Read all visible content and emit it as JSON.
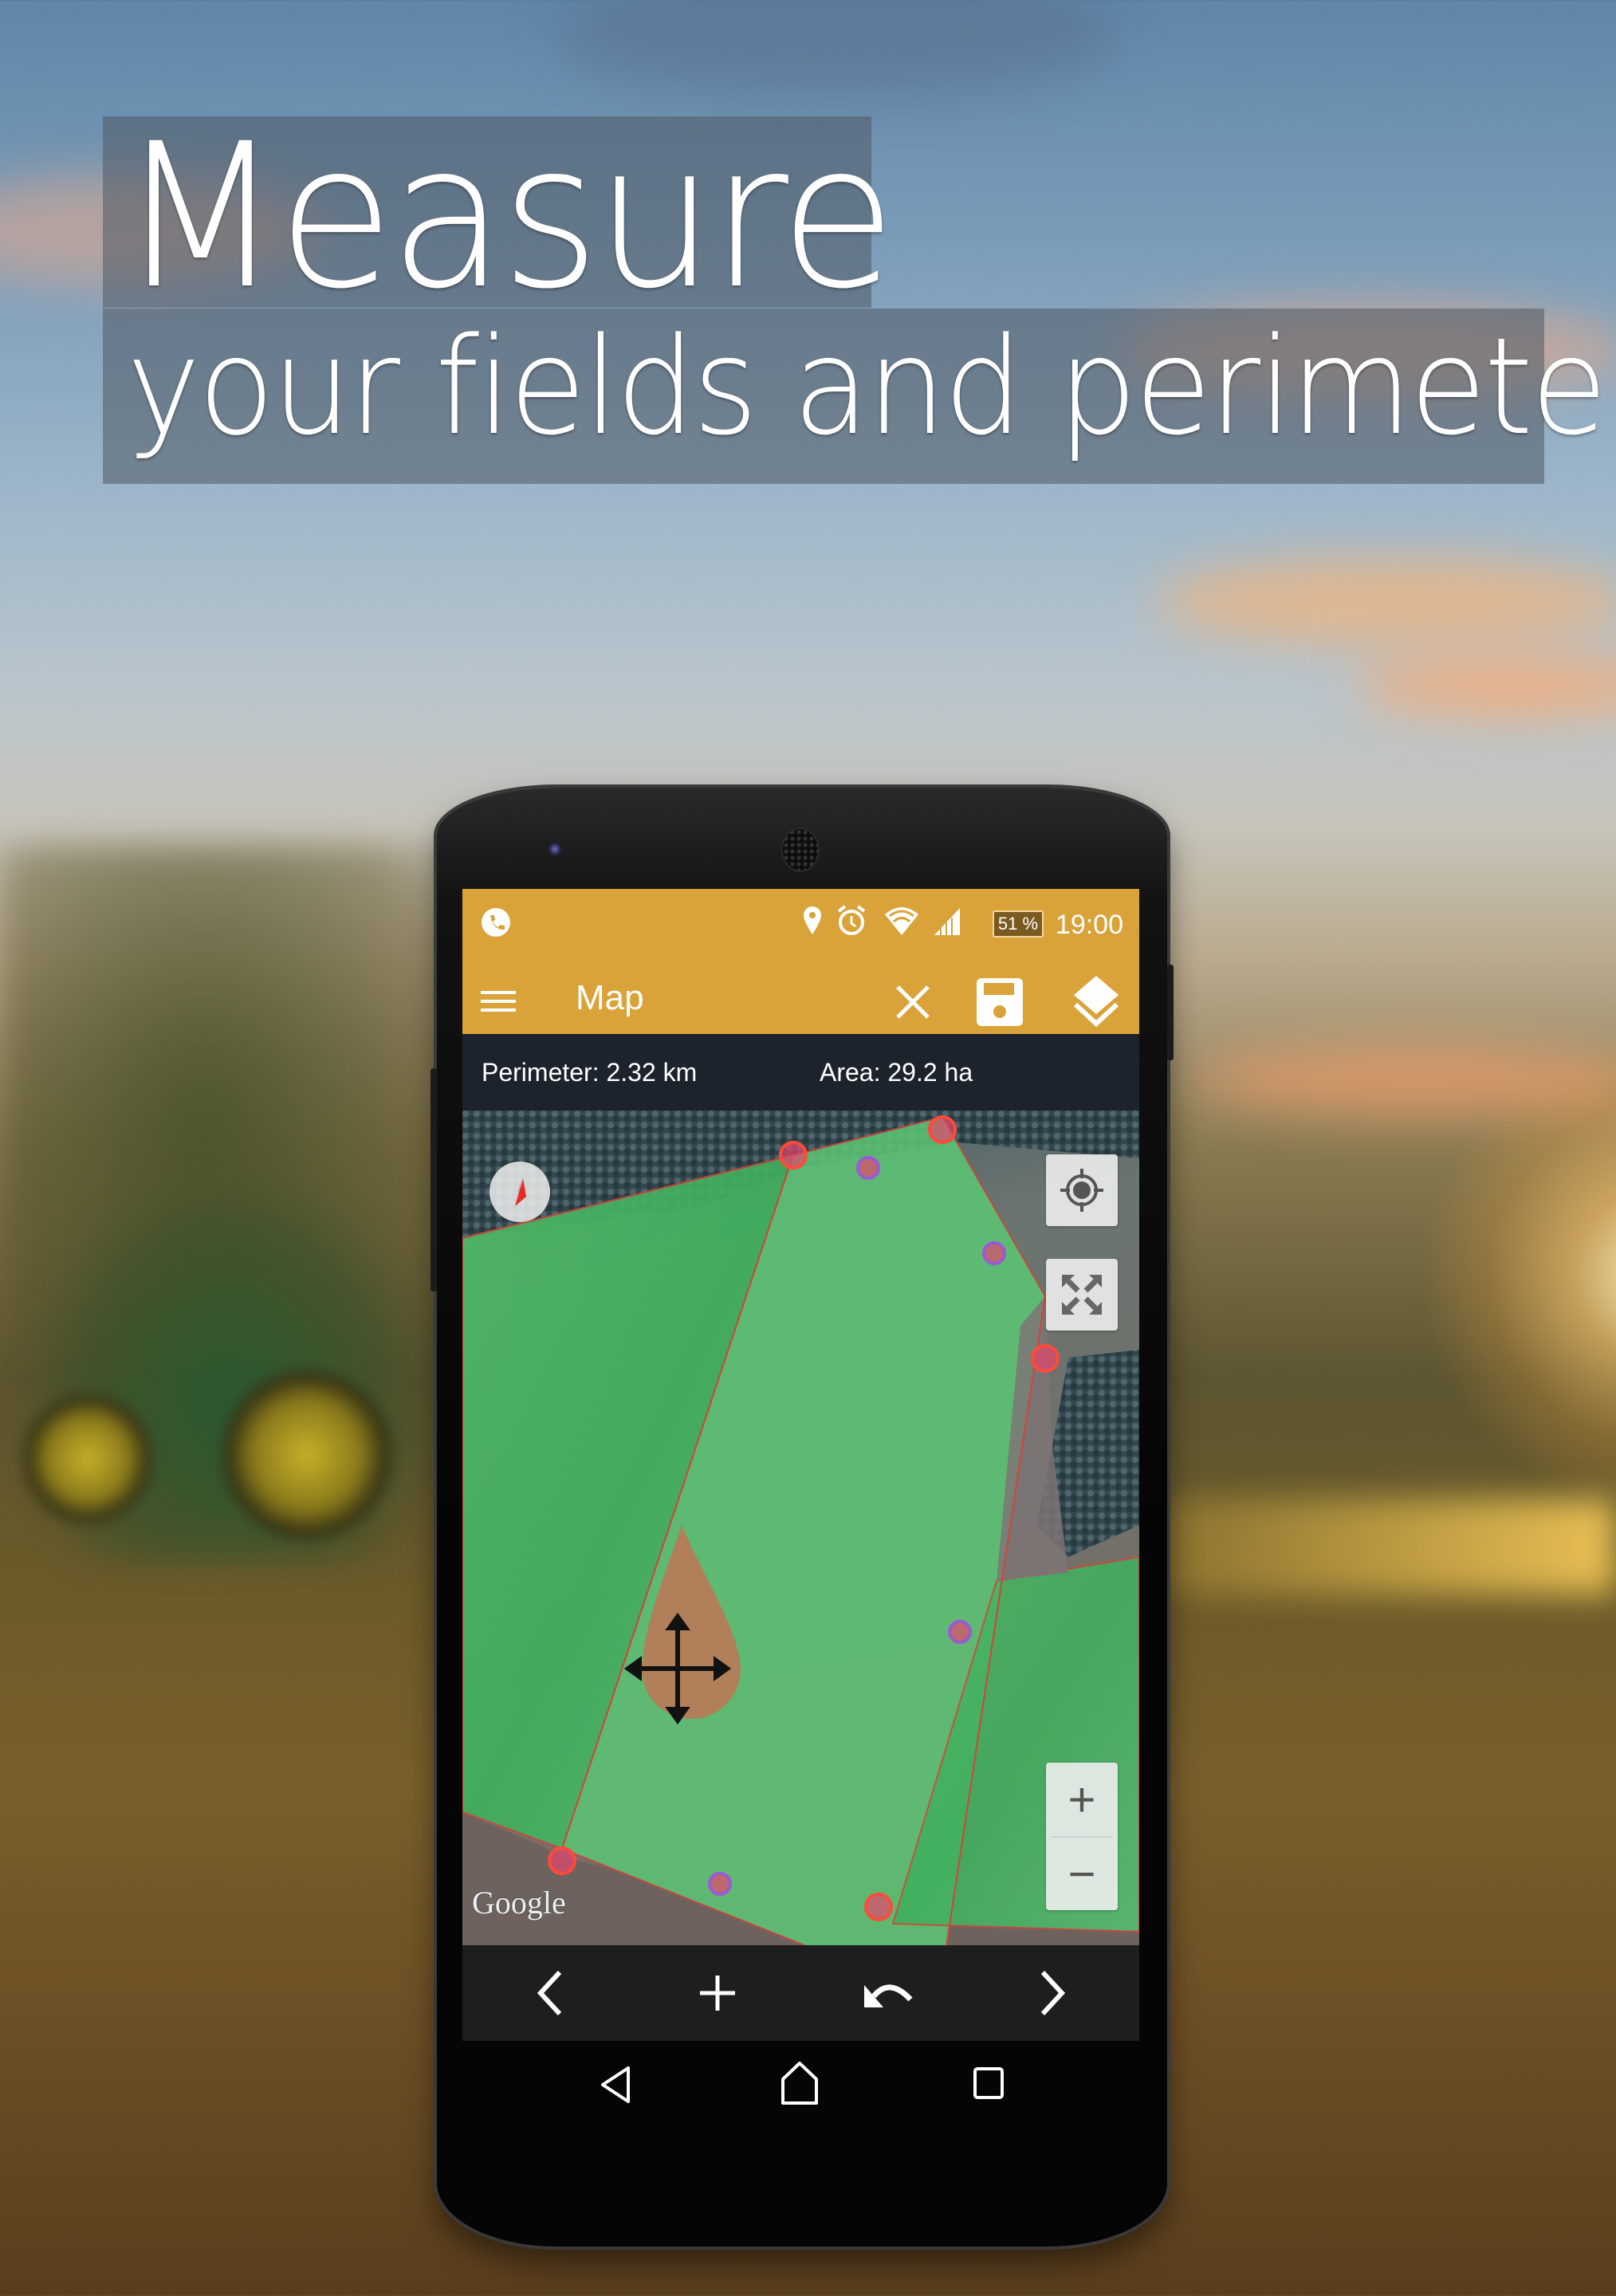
{
  "headline": {
    "line1": "Measure",
    "line2": "your fields and perimeter"
  },
  "status_bar": {
    "left_icon": "phone-icon",
    "icons": [
      "location-pin-icon",
      "alarm-icon",
      "wifi-icon",
      "signal-icon"
    ],
    "battery": "51 %",
    "time": "19:00"
  },
  "app_bar": {
    "menu_icon": "hamburger-menu-icon",
    "title": "Map",
    "actions": [
      {
        "name": "close",
        "icon": "close-icon"
      },
      {
        "name": "save",
        "icon": "save-icon"
      },
      {
        "name": "layers",
        "icon": "layers-icon"
      }
    ],
    "color": "#d9a339"
  },
  "measurement": {
    "perimeter": "Perimeter: 2.32 km",
    "area": "Area: 29.2 ha"
  },
  "map": {
    "attribution": "Google",
    "controls": {
      "compass": "compass-icon",
      "my_location": "my-location-icon",
      "fullscreen": "fullscreen-icon",
      "zoom_in": "+",
      "zoom_out": "−"
    },
    "polygon_color": "#e0453a",
    "midpoint_color": "#9b59d6",
    "fill_color": "#3cc45a"
  },
  "bottom_toolbar": {
    "buttons": [
      {
        "name": "previous",
        "icon": "chevron-left-icon"
      },
      {
        "name": "add-point",
        "icon": "plus-icon"
      },
      {
        "name": "undo",
        "icon": "undo-icon"
      },
      {
        "name": "next",
        "icon": "chevron-right-icon"
      }
    ]
  },
  "system_nav": {
    "buttons": [
      "back-icon",
      "home-icon",
      "recents-icon"
    ]
  }
}
